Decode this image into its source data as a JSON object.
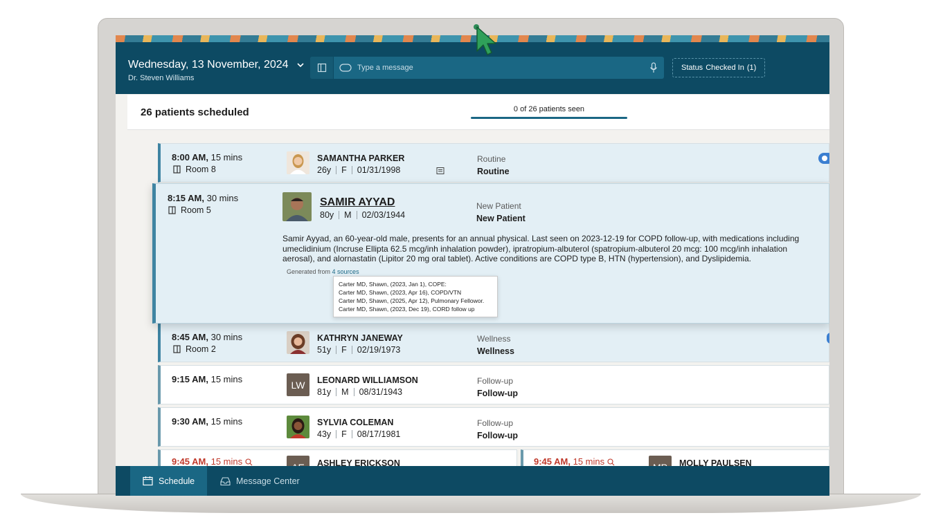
{
  "header": {
    "date_title": "Wednesday, 13 November, 2024",
    "doctor": "Dr. Steven Williams",
    "message_placeholder": "Type a message",
    "status_label": "Status",
    "status_value": "Checked In",
    "status_count": "(1)"
  },
  "summary": {
    "scheduled": "26 patients scheduled",
    "seen": "0 of 26 patients seen"
  },
  "appointments": [
    {
      "time": "8:00 AM,",
      "duration": " 15 mins",
      "room": "Room 8",
      "name": "SAMANTHA PARKER",
      "age": "26y",
      "sex": "F",
      "dob": "01/31/1998",
      "visit_type": "Routine",
      "visit_label": "Routine"
    },
    {
      "time": "8:15 AM,",
      "duration": " 30 mins",
      "room": "Room 5",
      "name": "SAMIR AYYAD",
      "age": "80y",
      "sex": "M",
      "dob": "02/03/1944",
      "visit_type": "New Patient",
      "visit_label": "New Patient",
      "ai_summary": "Samir Ayyad, an 60-year-old male, presents for an annual physical. Last seen on 2023-12-19 for COPD follow-up, with medications including umeclidinium (Incruse Ellipta 62.5 mcg/inh inhalation powder), ipratropium-albuterol (spatropium-albuterol 20 mcg: 100 mcg/inh inhalation aerosal), and alornastatin (Lipitor 20 mg oral tablet). Active conditions are COPD type B, HTN (hypertension), and Dyslipidemia.",
      "generated_from": "Generated from",
      "sources_link": "4 sources",
      "sources": [
        "Carter MD, Shawn, (2023, Jan 1), COPE:",
        "Carter MD, Shawn, (2023, Apr 16), COPD/VTN",
        "Carter MD, Shawn, (2025, Apr 12), Pulmonary Fellowor.",
        "Carter MD, Shawn, (2023, Dec 19), CORD follow up"
      ]
    },
    {
      "time": "8:45 AM,",
      "duration": " 30 mins",
      "room": "Room 2",
      "name": "KATHRYN JANEWAY",
      "age": "51y",
      "sex": "F",
      "dob": "02/19/1973",
      "visit_type": "Wellness",
      "visit_label": "Wellness"
    },
    {
      "time": "9:15 AM,",
      "duration": " 15 mins",
      "initials": "LW",
      "name": "LEONARD WILLIAMSON",
      "age": "81y",
      "sex": "M",
      "dob": "08/31/1943",
      "visit_type": "Follow-up",
      "visit_label": "Follow-up"
    },
    {
      "time": "9:30 AM,",
      "duration": " 15 mins",
      "name": "SYLVIA COLEMAN",
      "age": "43y",
      "sex": "F",
      "dob": "08/17/1981",
      "visit_type": "Follow-up",
      "visit_label": "Follow-up"
    },
    {
      "time": "9:45 AM,",
      "duration": " 15 mins",
      "initials": "AE",
      "name": "ASHLEY ERICKSON"
    },
    {
      "time": "9:45 AM,",
      "duration": " 15 mins",
      "initials": "MP",
      "name": "MOLLY PAULSEN"
    }
  ],
  "tabs": {
    "schedule": "Schedule",
    "message_center": "Message Center"
  },
  "colors": {
    "header_bg": "#0d4a63",
    "accent": "#1a6784",
    "late_time": "#c0392b"
  }
}
